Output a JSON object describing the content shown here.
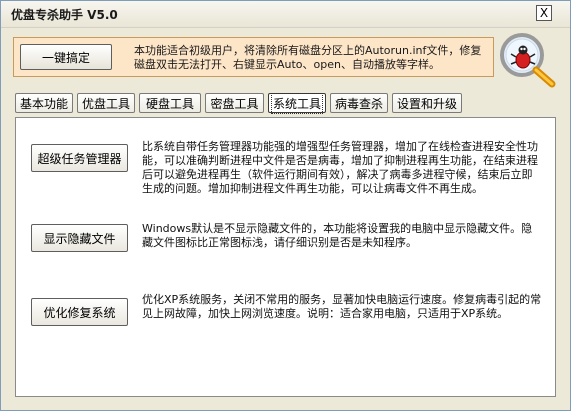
{
  "window": {
    "title": "优盘专杀助手  V5.0",
    "close_label": "X"
  },
  "banner": {
    "oneclick_label": "一键搞定",
    "description_line1": "本功能适合初级用户，将清除所有磁盘分区上的Autorun.inf文件，修复",
    "description_line2": "磁盘双击无法打开、右键显示Auto、open、自动播放等字样。",
    "logo_icon": "magnifier-bug-icon"
  },
  "tabs": [
    {
      "label": "基本功能",
      "active": false
    },
    {
      "label": "优盘工具",
      "active": false
    },
    {
      "label": "硬盘工具",
      "active": false
    },
    {
      "label": "密盘工具",
      "active": false
    },
    {
      "label": "系统工具",
      "active": true
    },
    {
      "label": "病毒查杀",
      "active": false
    },
    {
      "label": "设置和升级",
      "active": false
    }
  ],
  "features": [
    {
      "button_label": "超级任务管理器",
      "description": "比系统自带任务管理器功能强的增强型任务管理器，增加了在线检查进程安全性功能，可以准确判断进程中文件是否是病毒，增加了抑制进程再生功能，在结束进程后可以避免进程再生（软件运行期间有效），解决了病毒多进程守候，结束后立即生成的问题。增加抑制进程文件再生功能，可以让病毒文件不再生成。"
    },
    {
      "button_label": "显示隐藏文件",
      "description": "Windows默认是不显示隐藏文件的，本功能将设置我的电脑中显示隐藏文件。隐藏文件图标比正常图标浅，请仔细识别是否是未知程序。"
    },
    {
      "button_label": "优化修复系统",
      "description": "优化XP系统服务，关闭不常用的服务，显著加快电脑运行速度。修复病毒引起的常见上网故障，加快上网浏览速度。说明：适合家用电脑，只适用于XP系统。"
    }
  ],
  "colors": {
    "window_bg": "#ece9d8",
    "banner_bg": "#fde5c8",
    "banner_border": "#c99a5a",
    "panel_bg": "#ffffff"
  }
}
